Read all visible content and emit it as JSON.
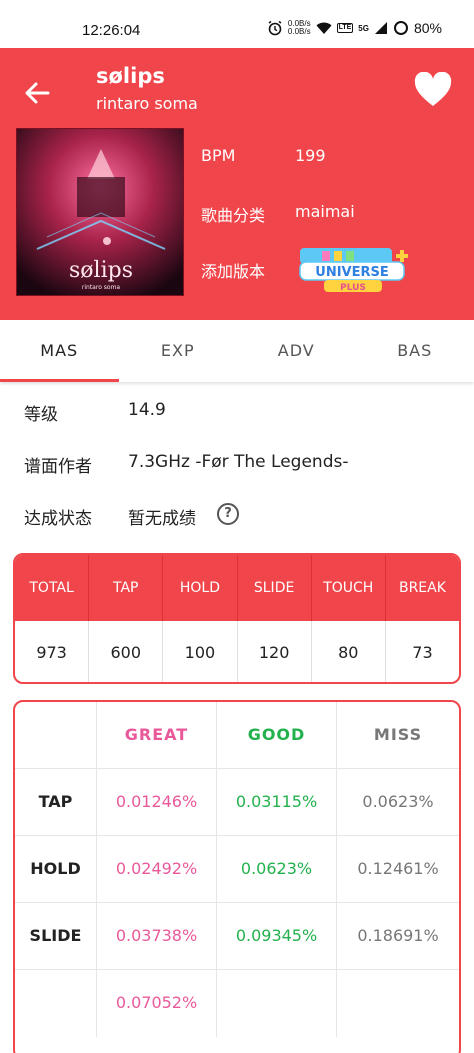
{
  "status": {
    "time": "12:26:04",
    "net_up": "0.0B/s",
    "net_down": "0.0B/s",
    "battery": "80%",
    "signal_tag": "5G",
    "volte_tag": "LTE"
  },
  "header": {
    "title": "sølips",
    "artist": "rintaro soma",
    "cover_title": "sølips",
    "cover_artist": "rintaro soma",
    "bpm_label": "BPM",
    "bpm_value": "199",
    "genre_label": "歌曲分类",
    "genre_value": "maimai",
    "version_label": "添加版本",
    "version_logo_text": "UNIVERSE",
    "version_logo_sub": "PLUS",
    "accent": "#f0454a"
  },
  "tabs": [
    {
      "label": "MAS",
      "active": true
    },
    {
      "label": "EXP",
      "active": false
    },
    {
      "label": "ADV",
      "active": false
    },
    {
      "label": "BAS",
      "active": false
    }
  ],
  "details": {
    "level_label": "等级",
    "level_value": "14.9",
    "charter_label": "谱面作者",
    "charter_value": "7.3GHz -Før The Legends-",
    "status_label": "达成状态",
    "status_value": "暂无成绩",
    "help_glyph": "?"
  },
  "notes": {
    "headers": [
      "TOTAL",
      "TAP",
      "HOLD",
      "SLIDE",
      "TOUCH",
      "BREAK"
    ],
    "values": [
      "973",
      "600",
      "100",
      "120",
      "80",
      "73"
    ]
  },
  "judge": {
    "headers": [
      "GREAT",
      "GOOD",
      "MISS"
    ],
    "rows": [
      {
        "label": "TAP",
        "great": "0.01246%",
        "good": "0.03115%",
        "miss": "0.0623%"
      },
      {
        "label": "HOLD",
        "great": "0.02492%",
        "good": "0.0623%",
        "miss": "0.12461%"
      },
      {
        "label": "SLIDE",
        "great": "0.03738%",
        "good": "0.09345%",
        "miss": "0.18691%"
      },
      {
        "label": "",
        "great": "0.07052%",
        "good": "",
        "miss": ""
      }
    ],
    "colors": {
      "great": "#e9599a",
      "good": "#23b14d",
      "miss": "#777777"
    }
  }
}
